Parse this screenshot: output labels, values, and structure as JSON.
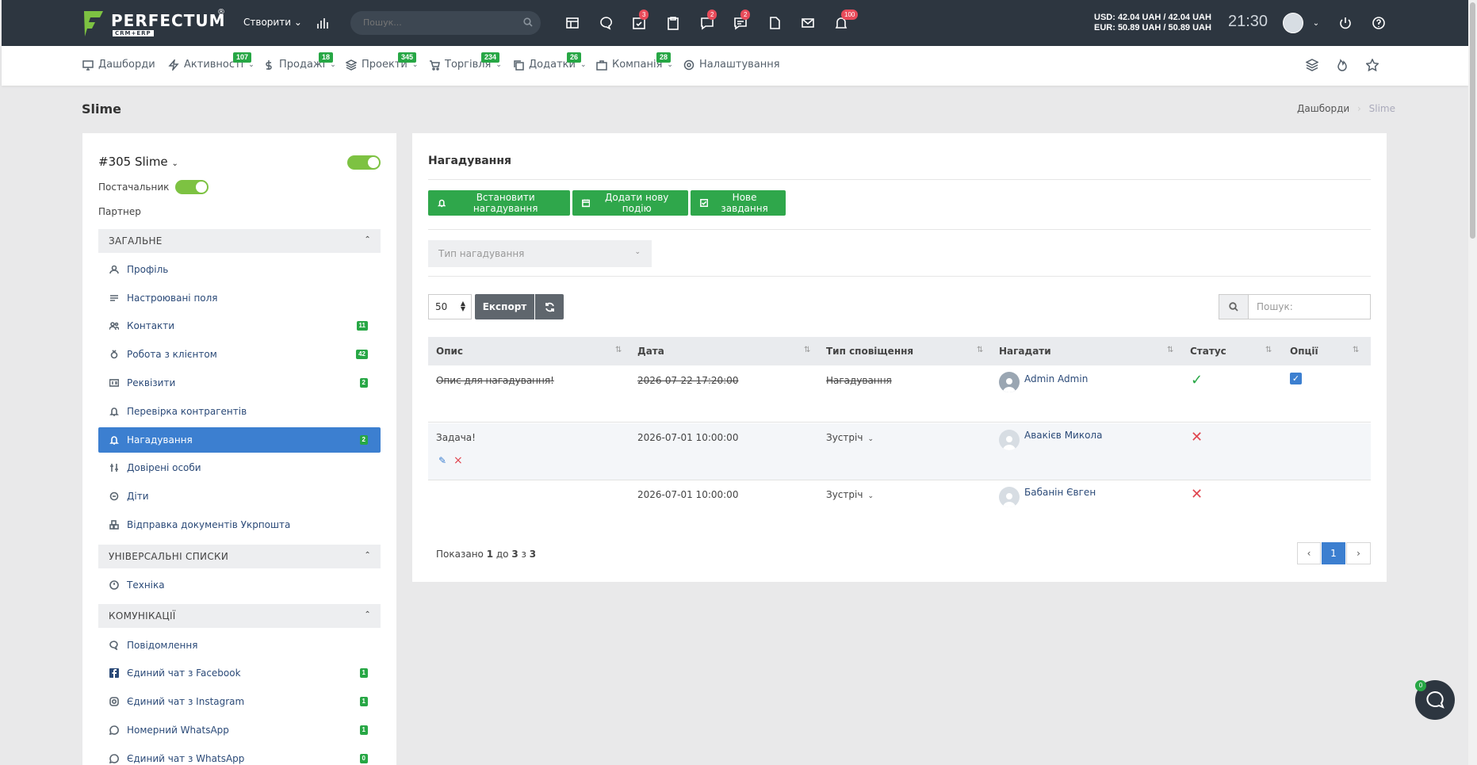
{
  "app": {
    "logo_text": "PERFECTUM",
    "logo_sub": "CRM+ERP",
    "logo_reg": "®",
    "create_label": "Створити",
    "search_placeholder": "Пошук...",
    "badges": {
      "tasks": "3",
      "messages": "2",
      "chats": "2",
      "notifications": "100"
    },
    "rates": {
      "usd": "USD: 42.04 UAH / 42.04 UAH",
      "eur": "EUR: 50.89 UAH / 50.89 UAH"
    },
    "time": "21:30"
  },
  "nav": {
    "items": [
      {
        "label": "Дашборди",
        "badge": "",
        "icon": "dashboard-icon"
      },
      {
        "label": "Активності",
        "badge": "107",
        "icon": "bolt-icon"
      },
      {
        "label": "Продажі",
        "badge": "18",
        "icon": "dollar-icon"
      },
      {
        "label": "Проекти",
        "badge": "345",
        "icon": "layers-icon"
      },
      {
        "label": "Торгівля",
        "badge": "234",
        "icon": "cart-icon"
      },
      {
        "label": "Додатки",
        "badge": "26",
        "icon": "copy-icon"
      },
      {
        "label": "Компанія",
        "badge": "28",
        "icon": "briefcase-icon"
      },
      {
        "label": "Налаштування",
        "badge": "",
        "icon": "gear-icon"
      }
    ]
  },
  "page": {
    "title": "Slime",
    "breadcrumb": {
      "home": "Дашборди",
      "sep": "›",
      "current": "Slime"
    }
  },
  "sidebar": {
    "client_name": "#305 Slime",
    "supplier_label": "Постачальник",
    "partner_label": "Партнер",
    "sections": {
      "general": "ЗАГАЛЬНЕ",
      "universal": "УНІВЕРСАЛЬНІ СПИСКИ",
      "comms": "КОМУНІКАЦІЇ"
    },
    "general_items": [
      {
        "label": "Профіль",
        "badge": ""
      },
      {
        "label": "Настроювані поля",
        "badge": ""
      },
      {
        "label": "Контакти",
        "badge": "11"
      },
      {
        "label": "Робота з клієнтом",
        "badge": "42"
      },
      {
        "label": "Реквізити",
        "badge": "2"
      },
      {
        "label": "Перевірка контрагентів",
        "badge": ""
      },
      {
        "label": "Нагадування",
        "badge": "2"
      },
      {
        "label": "Довірені особи",
        "badge": ""
      },
      {
        "label": "Діти",
        "badge": ""
      },
      {
        "label": "Відправка документів Укрпошта",
        "badge": ""
      }
    ],
    "universal_items": [
      {
        "label": "Техніка",
        "badge": ""
      }
    ],
    "comms_items": [
      {
        "label": "Повідомлення",
        "badge": ""
      },
      {
        "label": "Єдиний чат з Facebook",
        "badge": "1"
      },
      {
        "label": "Єдиний чат з Instagram",
        "badge": "1"
      },
      {
        "label": "Номерний WhatsApp",
        "badge": "1"
      },
      {
        "label": "Єдиний чат з WhatsApp",
        "badge": "0"
      }
    ]
  },
  "main": {
    "title": "Нагадування",
    "buttons": {
      "set_reminder": "Встановити нагадування",
      "add_event": "Додати нову подію",
      "new_task": "Нове завдання"
    },
    "type_select_placeholder": "Тип нагадування",
    "page_length": "50",
    "export_label": "Експорт",
    "search_placeholder": "Пошук:",
    "columns": [
      "Опис",
      "Дата",
      "Тип сповіщення",
      "Нагадати",
      "Статус",
      "Опції"
    ],
    "rows": [
      {
        "description": "Опис для нагадування!",
        "date": "2026-07-22 17:20:00",
        "type": "Нагадування",
        "remind": "Admin Admin",
        "status": "done",
        "completed": true
      },
      {
        "description": "Задача!",
        "date": "2026-07-01 10:00:00",
        "type": "Зустріч",
        "remind": "Авакієв Микола",
        "status": "not-done",
        "completed": false
      },
      {
        "description": "",
        "date": "2026-07-01 10:00:00",
        "type": "Зустріч",
        "remind": "Бабанін Євген",
        "status": "not-done",
        "completed": false
      }
    ],
    "info": {
      "prefix": "Показано ",
      "from": "1",
      "mid1": " до ",
      "to": "3",
      "mid2": " з ",
      "total": "3"
    },
    "pagination": {
      "prev": "‹",
      "current": "1",
      "next": "›"
    }
  },
  "chat": {
    "badge": "0"
  }
}
